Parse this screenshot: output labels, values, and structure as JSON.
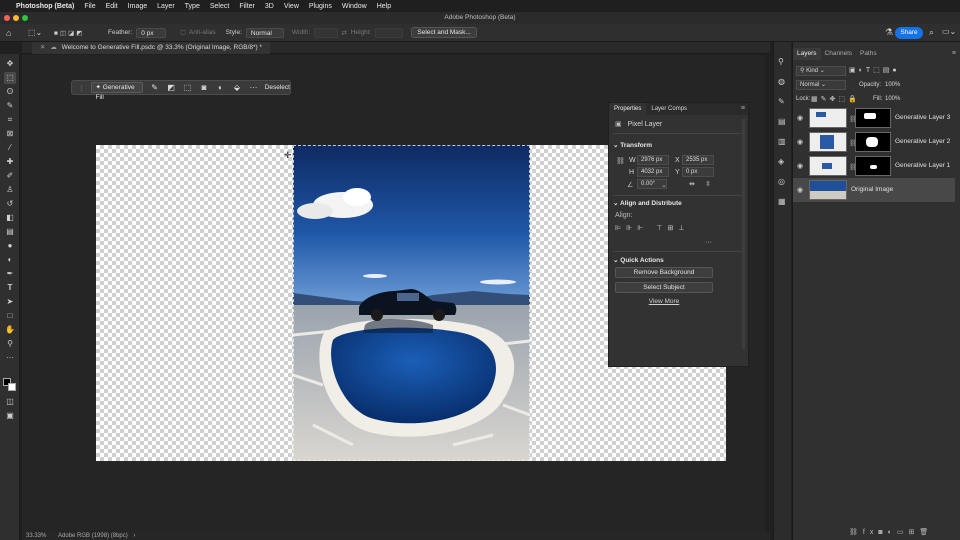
{
  "menubar": {
    "apple": "",
    "app": "Photoshop (Beta)",
    "items": [
      "File",
      "Edit",
      "Image",
      "Layer",
      "Type",
      "Select",
      "Filter",
      "3D",
      "View",
      "Plugins",
      "Window",
      "Help"
    ]
  },
  "window": {
    "title": "Adobe Photoshop (Beta)"
  },
  "options": {
    "feather_label": "Feather:",
    "feather_value": "0 px",
    "antialias": "Anti-alias",
    "style_label": "Style:",
    "style_value": "Normal",
    "width_label": "Width:",
    "height_label": "Height:",
    "select_mask": "Select and Mask...",
    "share": "Share"
  },
  "document": {
    "tab_title": "Welcome to Generative Fill.psdc @ 33.3% (Original Image, RGB/8*) *"
  },
  "contextbar": {
    "generative_fill": "Generative Fill",
    "deselect": "Deselect"
  },
  "properties": {
    "tabs": [
      "Properties",
      "Layer Comps"
    ],
    "kind": "Pixel Layer",
    "transform_title": "Transform",
    "w_label": "W",
    "w_value": "2976 px",
    "x_label": "X",
    "x_value": "2535 px",
    "h_label": "H",
    "h_value": "4032 px",
    "y_label": "Y",
    "y_value": "0 px",
    "angle_value": "0.00°",
    "align_title": "Align and Distribute",
    "align_label": "Align:",
    "quick_title": "Quick Actions",
    "remove_bg": "Remove Background",
    "select_subject": "Select Subject",
    "view_more": "View More"
  },
  "layers_panel": {
    "tabs": [
      "Layers",
      "Channels",
      "Paths"
    ],
    "filter": "Kind",
    "blend": "Normal",
    "opacity_label": "Opacity:",
    "opacity_value": "100%",
    "lock_label": "Lock:",
    "fill_label": "Fill:",
    "fill_value": "100%",
    "layers": [
      {
        "name": "Generative Layer 3"
      },
      {
        "name": "Generative Layer 2"
      },
      {
        "name": "Generative Layer 1"
      },
      {
        "name": "Original Image"
      }
    ]
  },
  "status": {
    "zoom": "33.33%",
    "profile": "Adobe RGB (1998) (8bpc)"
  },
  "colors": {
    "accent": "#1473e6",
    "panel": "#323232",
    "sky": "#1f4f9a"
  }
}
